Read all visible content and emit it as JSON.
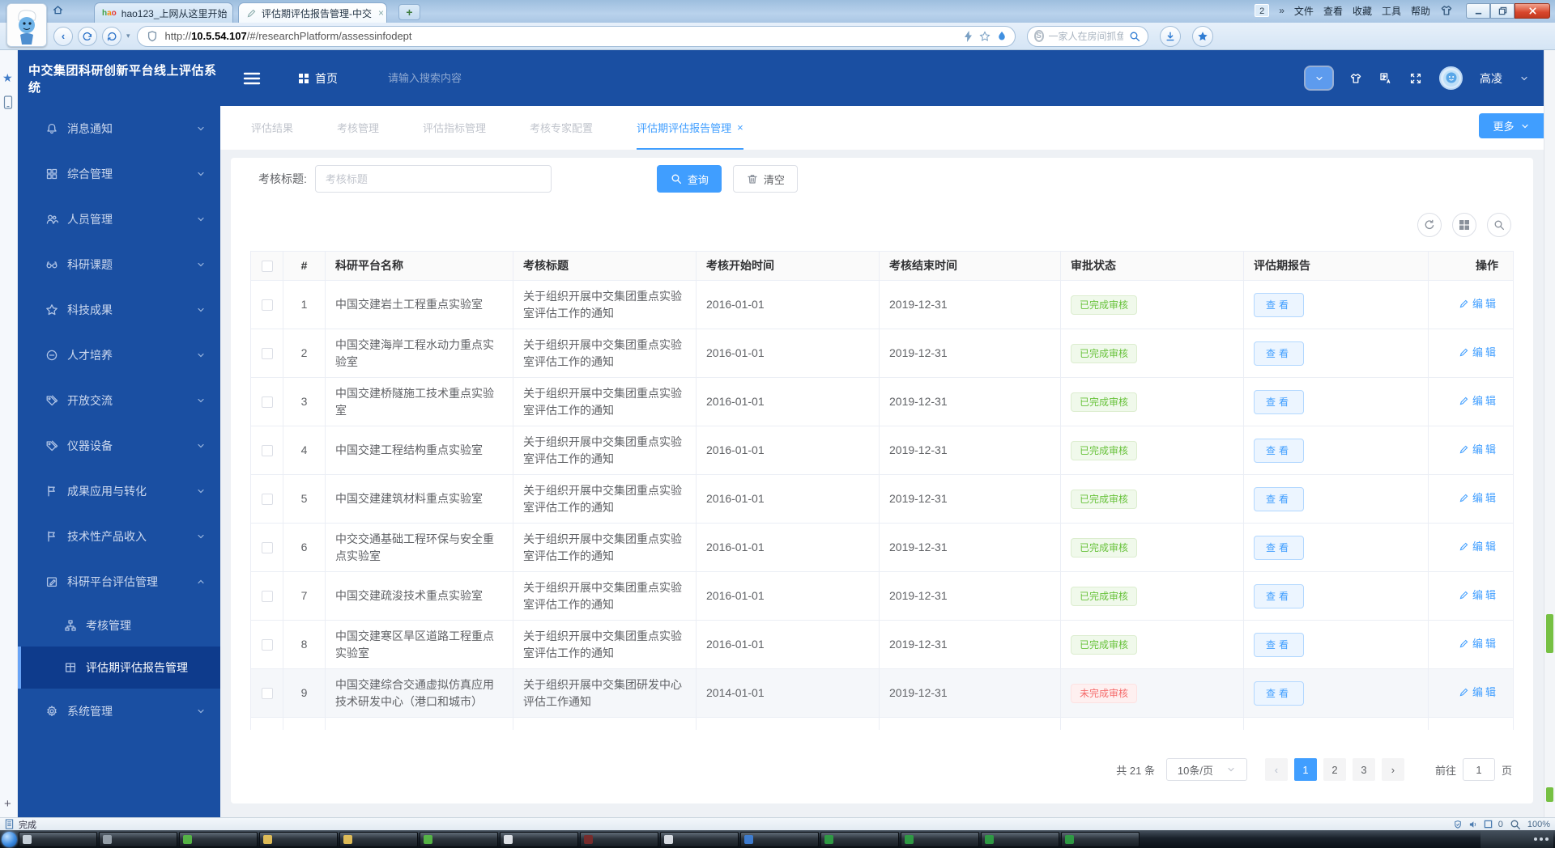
{
  "colors": {
    "accent": "#409EFF",
    "navy": "#1A4FA2",
    "badge_done": "#67C23A",
    "badge_pending": "#F56C6C",
    "scroll_thumb": "#76C043"
  },
  "browser": {
    "tab1": "hao123_上网从这里开始",
    "tab2": "评估期评估报告管理-中交",
    "overflow_badge": "2",
    "menu": [
      "文件",
      "查看",
      "收藏",
      "工具",
      "帮助"
    ],
    "url_prefix": "http://",
    "url_host": "10.5.54.107",
    "url_path": "/#/researchPlatform/assessinfodept",
    "search_placeholder": "一家人在房间抓鱼",
    "status_text": "完成",
    "tray_count": "0",
    "zoom_level": "100%"
  },
  "app": {
    "title": "中交集团科研创新平台线上评估系统",
    "nav_home": "首页",
    "header_search_placeholder": "请输入搜索内容",
    "username": "高凌",
    "sidebar": {
      "items": [
        {
          "icon": "bell",
          "label": "消息通知"
        },
        {
          "icon": "grid4",
          "label": "综合管理"
        },
        {
          "icon": "users",
          "label": "人员管理"
        },
        {
          "icon": "glasses",
          "label": "科研课题"
        },
        {
          "icon": "star",
          "label": "科技成果"
        },
        {
          "icon": "minuscir",
          "label": "人才培养"
        },
        {
          "icon": "tags",
          "label": "开放交流"
        },
        {
          "icon": "tags",
          "label": "仪器设备"
        },
        {
          "icon": "flag",
          "label": "成果应用与转化"
        },
        {
          "icon": "flag",
          "label": "技术性产品收入"
        },
        {
          "icon": "editsq",
          "label": "科研平台评估管理",
          "expanded": true
        },
        {
          "icon": "sitemap",
          "label": "考核管理",
          "sub": true
        },
        {
          "icon": "report",
          "label": "评估期评估报告管理",
          "sub": true,
          "active": true
        },
        {
          "icon": "gear",
          "label": "系统管理"
        }
      ]
    },
    "tabs": [
      {
        "label": "评估结果"
      },
      {
        "label": "考核管理"
      },
      {
        "label": "评估指标管理"
      },
      {
        "label": "考核专家配置"
      },
      {
        "label": "评估期评估报告管理",
        "active": true,
        "closable": true
      }
    ],
    "more_button": "更多",
    "filter": {
      "label": "考核标题:",
      "placeholder": "考核标题",
      "search": "查询",
      "clear": "清空"
    },
    "table": {
      "columns": [
        "#",
        "科研平台名称",
        "考核标题",
        "考核开始时间",
        "考核结束时间",
        "审批状态",
        "评估期报告",
        "操作"
      ],
      "view_label": "查看",
      "edit_label": "编辑",
      "status_done": "已完成审核",
      "status_pending": "未完成审核",
      "rows": [
        {
          "num": "1",
          "name": "中国交建岩土工程重点实验室",
          "title": "关于组织开展中交集团重点实验室评估工作的通知",
          "start": "2016-01-01",
          "end": "2019-12-31",
          "status": "done"
        },
        {
          "num": "2",
          "name": "中国交建海岸工程水动力重点实验室",
          "title": "关于组织开展中交集团重点实验室评估工作的通知",
          "start": "2016-01-01",
          "end": "2019-12-31",
          "status": "done"
        },
        {
          "num": "3",
          "name": "中国交建桥隧施工技术重点实验室",
          "title": "关于组织开展中交集团重点实验室评估工作的通知",
          "start": "2016-01-01",
          "end": "2019-12-31",
          "status": "done"
        },
        {
          "num": "4",
          "name": "中国交建工程结构重点实验室",
          "title": "关于组织开展中交集团重点实验室评估工作的通知",
          "start": "2016-01-01",
          "end": "2019-12-31",
          "status": "done"
        },
        {
          "num": "5",
          "name": "中国交建建筑材料重点实验室",
          "title": "关于组织开展中交集团重点实验室评估工作的通知",
          "start": "2016-01-01",
          "end": "2019-12-31",
          "status": "done"
        },
        {
          "num": "6",
          "name": "中交交通基础工程环保与安全重点实验室",
          "title": "关于组织开展中交集团重点实验室评估工作的通知",
          "start": "2016-01-01",
          "end": "2019-12-31",
          "status": "done"
        },
        {
          "num": "7",
          "name": "中国交建疏浚技术重点实验室",
          "title": "关于组织开展中交集团重点实验室评估工作的通知",
          "start": "2016-01-01",
          "end": "2019-12-31",
          "status": "done"
        },
        {
          "num": "8",
          "name": "中国交建寒区旱区道路工程重点实验室",
          "title": "关于组织开展中交集团重点实验室评估工作的通知",
          "start": "2016-01-01",
          "end": "2019-12-31",
          "status": "done"
        },
        {
          "num": "9",
          "name": "中国交建综合交通虚拟仿真应用技术研发中心（港口和城市）",
          "title": "关于组织开展中交集团研发中心评估工作通知",
          "start": "2014-01-01",
          "end": "2019-12-31",
          "status": "pending",
          "highlight": true
        }
      ]
    },
    "pagination": {
      "total": "共 21 条",
      "per_page": "10条/页",
      "pages": [
        "1",
        "2",
        "3"
      ],
      "current": "1",
      "goto_label": "前往",
      "goto_value": "1",
      "page_unit": "页"
    }
  }
}
